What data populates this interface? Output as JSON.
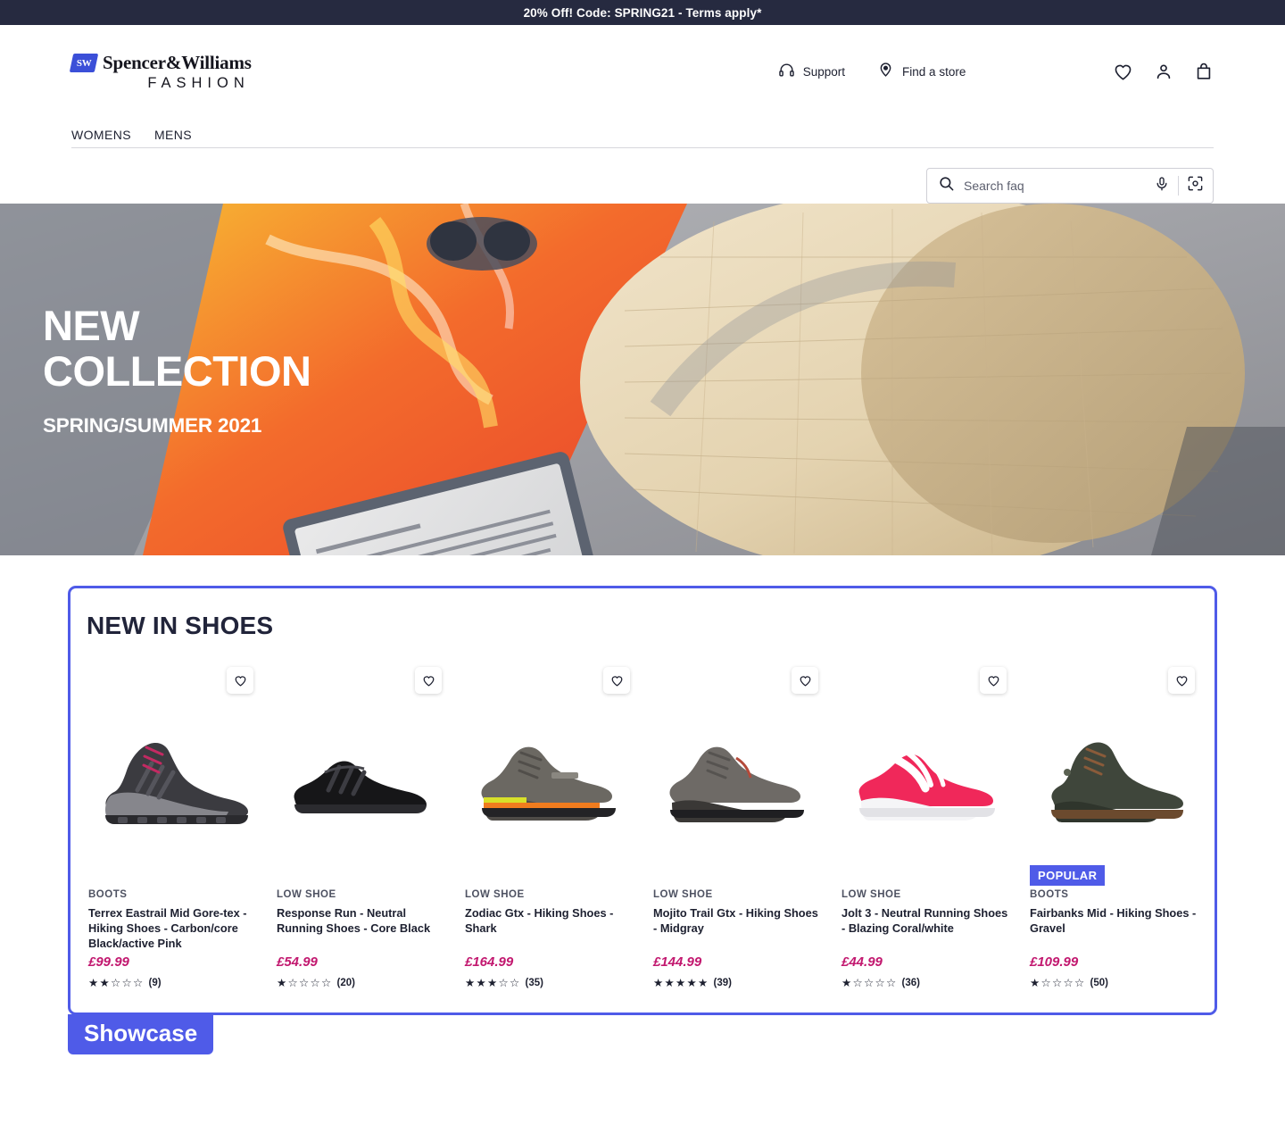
{
  "promo": {
    "text": "20% Off! Code: SPRING21 - Terms apply*"
  },
  "brand": {
    "mark": "SW",
    "name": "Spencer&Williams",
    "tagline": "FASHION"
  },
  "header": {
    "links": [
      {
        "label": "Support",
        "icon": "headset-icon"
      },
      {
        "label": "Find a store",
        "icon": "location-pin-icon"
      }
    ],
    "icons": [
      "heart-icon",
      "account-icon",
      "shopping-bag-icon"
    ]
  },
  "nav": {
    "items": [
      {
        "label": "WOMENS"
      },
      {
        "label": "MENS"
      }
    ]
  },
  "search": {
    "placeholder": "Search faq",
    "value": "",
    "icons": [
      "search-icon",
      "microphone-icon",
      "lens-scan-icon"
    ]
  },
  "hero": {
    "line1": "NEW",
    "line2": "COLLECTION",
    "line3": "SPRING/SUMMER 2021"
  },
  "showcase": {
    "title": "NEW IN SHOES",
    "annotation_label": "Showcase",
    "accent_color": "#4f5be8",
    "price_color": "#c2186f",
    "products": [
      {
        "category": "BOOTS",
        "name": "Terrex Eastrail Mid Gore-tex - Hiking Shoes - Carbon/core Black/active Pink",
        "price": "£99.99",
        "rating": 2,
        "reviews": "(9)",
        "badge": ""
      },
      {
        "category": "LOW SHOE",
        "name": "Response Run - Neutral Running Shoes - Core Black",
        "price": "£54.99",
        "rating": 1,
        "reviews": "(20)",
        "badge": ""
      },
      {
        "category": "LOW SHOE",
        "name": "Zodiac Gtx - Hiking Shoes - Shark",
        "price": "£164.99",
        "rating": 3,
        "reviews": "(35)",
        "badge": ""
      },
      {
        "category": "LOW SHOE",
        "name": "Mojito Trail Gtx - Hiking Shoes - Midgray",
        "price": "£144.99",
        "rating": 5,
        "reviews": "(39)",
        "badge": ""
      },
      {
        "category": "LOW SHOE",
        "name": "Jolt 3 - Neutral Running Shoes - Blazing Coral/white",
        "price": "£44.99",
        "rating": 1,
        "reviews": "(36)",
        "badge": ""
      },
      {
        "category": "BOOTS",
        "name": "Fairbanks Mid - Hiking Shoes - Gravel",
        "price": "£109.99",
        "rating": 1,
        "reviews": "(50)",
        "badge": "POPULAR"
      }
    ]
  }
}
